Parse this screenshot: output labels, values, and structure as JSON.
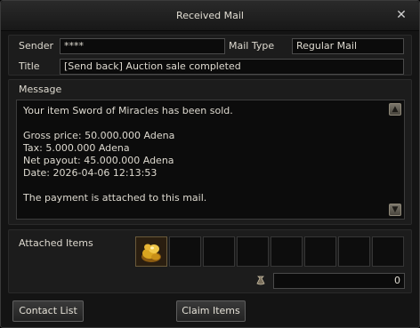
{
  "window": {
    "title": "Received Mail"
  },
  "header": {
    "sender_label": "Sender",
    "sender_value": "****",
    "mail_type_label": "Mail Type",
    "mail_type_value": "Regular Mail",
    "title_label": "Title",
    "title_value": "[Send back] Auction sale completed"
  },
  "message": {
    "label": "Message",
    "lines": [
      "Your item Sword of Miracles has been sold.",
      "",
      "Gross price: 50.000.000 Adena",
      "Tax: 5.000.000 Adena",
      "Net payout: 45.000.000 Adena",
      "Date: 2026-04-06 12:13:53",
      "",
      "The payment is attached to this mail."
    ]
  },
  "attachments": {
    "label": "Attached Items",
    "slots": [
      "adena-gold-icon",
      "",
      "",
      "",
      "",
      "",
      "",
      ""
    ],
    "adena_amount": "0"
  },
  "footer": {
    "contact_list_label": "Contact List",
    "claim_items_label": "Claim Items"
  }
}
